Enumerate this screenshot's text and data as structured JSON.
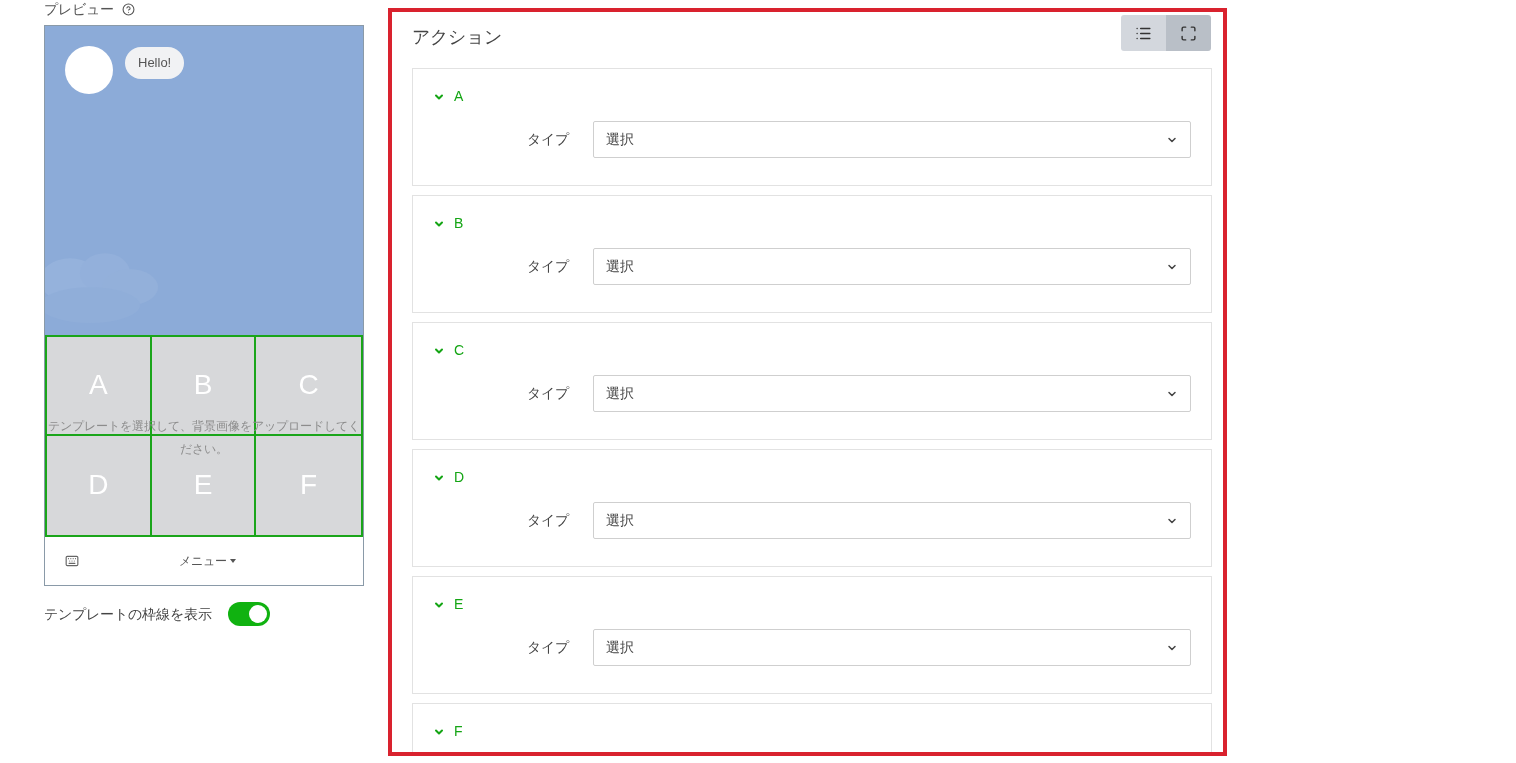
{
  "preview": {
    "label": "プレビュー",
    "bubble": "Hello!",
    "areas": [
      "A",
      "B",
      "C",
      "D",
      "E",
      "F"
    ],
    "hint": "テンプレートを選択して、背景画像をアップロードしてください。",
    "menu_label": "メニュー"
  },
  "border_toggle": {
    "label": "テンプレートの枠線を表示",
    "on": true
  },
  "actions": {
    "title": "アクション",
    "view_buttons": [
      {
        "kind": "list",
        "selected": false
      },
      {
        "kind": "fullscreen",
        "selected": true
      }
    ],
    "items": [
      {
        "label": "A",
        "expanded": true,
        "field_label": "タイプ",
        "value": "選択"
      },
      {
        "label": "B",
        "expanded": true,
        "field_label": "タイプ",
        "value": "選択"
      },
      {
        "label": "C",
        "expanded": true,
        "field_label": "タイプ",
        "value": "選択"
      },
      {
        "label": "D",
        "expanded": true,
        "field_label": "タイプ",
        "value": "選択"
      },
      {
        "label": "E",
        "expanded": true,
        "field_label": "タイプ",
        "value": "選択"
      },
      {
        "label": "F",
        "expanded": true
      }
    ]
  }
}
